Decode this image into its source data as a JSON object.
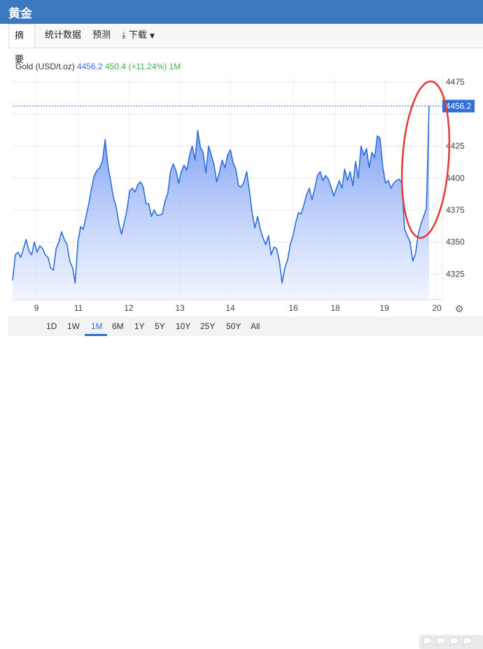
{
  "header": {
    "title": "黄金"
  },
  "tabs": [
    {
      "label": "摘要",
      "active": true
    },
    {
      "label": "统计数据"
    },
    {
      "label": "预测"
    },
    {
      "label": "下载"
    }
  ],
  "quote": {
    "name": "Gold (USD/t.oz)",
    "price": "4456.2",
    "change": "450.4 (+11.24%)",
    "range": "1M"
  },
  "ranges": [
    "1D",
    "1W",
    "1M",
    "6M",
    "1Y",
    "5Y",
    "10Y",
    "25Y",
    "50Y",
    "All"
  ],
  "active_range": "1M",
  "colors": {
    "line": "#2f6fd6",
    "accent": "#3a78bf",
    "up": "#3bb54a",
    "annotation": "#e53935"
  },
  "chart_data": {
    "type": "area",
    "x_tick_labels": [
      "9",
      "11",
      "12",
      "13",
      "14",
      "16",
      "18",
      "19",
      "20"
    ],
    "y_tick_labels": [
      "4325",
      "4350",
      "4375",
      "4400",
      "4425",
      "4475"
    ],
    "ylim": [
      4305,
      4480
    ],
    "last_value_label": "4456.2",
    "grid": true,
    "annotation": "red circle around the final spike",
    "x": [
      0,
      1,
      2,
      3,
      4,
      5,
      6,
      7,
      8,
      9,
      10,
      11,
      12,
      13,
      14,
      15,
      16,
      17,
      18,
      19,
      20,
      21,
      22,
      23,
      24,
      25,
      26,
      27,
      28,
      29,
      30,
      31,
      32,
      33,
      34,
      35,
      36,
      37,
      38,
      39,
      40,
      41,
      42,
      43,
      44,
      45,
      46,
      47,
      48,
      49,
      50,
      51,
      52,
      53,
      54,
      55,
      56,
      57,
      58,
      59,
      60,
      61,
      62,
      63,
      64,
      65,
      66,
      67,
      68,
      69,
      70,
      71,
      72,
      73,
      74,
      75,
      76,
      77,
      78,
      79,
      80,
      81,
      82,
      83,
      84,
      85,
      86,
      87,
      88,
      89,
      90,
      91,
      92,
      93,
      94,
      95,
      96,
      97,
      98,
      99,
      100,
      101,
      102,
      103,
      104,
      105,
      106,
      107,
      108,
      109,
      110,
      111,
      112,
      113,
      114,
      115,
      116,
      117,
      118,
      119,
      120,
      121,
      122,
      123,
      124,
      125,
      126,
      127,
      128,
      129,
      130,
      131,
      132,
      133,
      134,
      135,
      136,
      137,
      138,
      139,
      140,
      141,
      142,
      143,
      144,
      145,
      146,
      147,
      148,
      149,
      150
    ],
    "values": [
      4320,
      4340,
      4342,
      4338,
      4345,
      4352,
      4343,
      4340,
      4350,
      4342,
      4347,
      4345,
      4340,
      4338,
      4330,
      4328,
      4345,
      4350,
      4358,
      4352,
      4348,
      4335,
      4330,
      4318,
      4350,
      4362,
      4360,
      4370,
      4380,
      4392,
      4402,
      4406,
      4408,
      4413,
      4430,
      4410,
      4398,
      4385,
      4378,
      4365,
      4356,
      4365,
      4375,
      4390,
      4392,
      4389,
      4395,
      4397,
      4393,
      4380,
      4380,
      4370,
      4375,
      4371,
      4371,
      4372,
      4382,
      4388,
      4405,
      4411,
      4406,
      4396,
      4405,
      4410,
      4406,
      4418,
      4425,
      4414,
      4437,
      4424,
      4420,
      4404,
      4425,
      4418,
      4410,
      4397,
      4405,
      4414,
      4408,
      4418,
      4422,
      4412,
      4407,
      4394,
      4393,
      4397,
      4405,
      4390,
      4373,
      4361,
      4370,
      4360,
      4353,
      4348,
      4355,
      4340,
      4346,
      4345,
      4335,
      4318,
      4330,
      4336,
      4348,
      4355,
      4365,
      4373,
      4372,
      4379,
      4387,
      4392,
      4383,
      4392,
      4402,
      4405,
      4398,
      4402,
      4399,
      4393,
      4386,
      4392,
      4398,
      4392,
      4407,
      4398,
      4405,
      4394,
      4413,
      4400,
      4425,
      4418,
      4423,
      4408,
      4420,
      4416,
      4433,
      4431,
      4408,
      4396,
      4398,
      4392,
      4396,
      4398,
      4399,
      4396,
      4360,
      4355,
      4350,
      4335,
      4341,
      4356,
      4364
    ],
    "final_spike": [
      4364,
      4370,
      4376,
      4456.2
    ]
  }
}
